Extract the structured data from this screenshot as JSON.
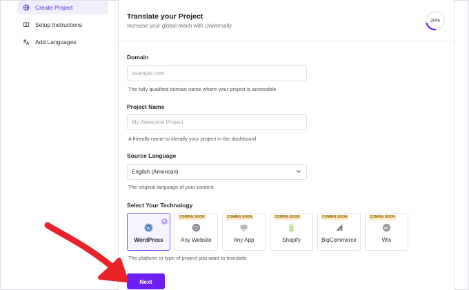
{
  "sidebar": {
    "items": [
      {
        "label": "Create Project",
        "icon": "globe-icon",
        "active": true
      },
      {
        "label": "Setup Instructions",
        "icon": "book-icon",
        "active": false
      },
      {
        "label": "Add Languages",
        "icon": "translate-icon",
        "active": false
      }
    ]
  },
  "header": {
    "title": "Translate your Project",
    "subtitle": "Increase your global reach with Universally",
    "progress_label": "20%",
    "progress_value": 0.2
  },
  "form": {
    "domain": {
      "label": "Domain",
      "placeholder": "example.com",
      "help": "The fully qualified domain name where your project is accessible"
    },
    "project_name": {
      "label": "Project Name",
      "placeholder": "My Awesome Project",
      "help": "A friendly name to identify your project in the dashboard"
    },
    "source_language": {
      "label": "Source Language",
      "value": "English (American)",
      "help": "The original language of your content"
    },
    "technology": {
      "label": "Select Your Technology",
      "help": "The platform or type of project you want to translate",
      "coming_soon_label": "COMING SOON",
      "options": [
        {
          "label": "WordPress",
          "icon": "wordpress-icon",
          "selected": true,
          "coming_soon": false
        },
        {
          "label": "Any Website",
          "icon": "globe-icon",
          "selected": false,
          "coming_soon": true
        },
        {
          "label": "Any App",
          "icon": "monitor-icon",
          "selected": false,
          "coming_soon": true
        },
        {
          "label": "Shopify",
          "icon": "shopify-bag-icon",
          "selected": false,
          "coming_soon": true
        },
        {
          "label": "BigCommerce",
          "icon": "bigcommerce-icon",
          "selected": false,
          "coming_soon": true
        },
        {
          "label": "Wix",
          "icon": "wix-icon",
          "selected": false,
          "coming_soon": true
        }
      ]
    },
    "next_label": "Next"
  },
  "colors": {
    "accent": "#6d1ef2",
    "active_nav_bg": "#f0eefb",
    "annotation_arrow": "#e8232a",
    "coming_soon_bg": "#fde9b8"
  }
}
